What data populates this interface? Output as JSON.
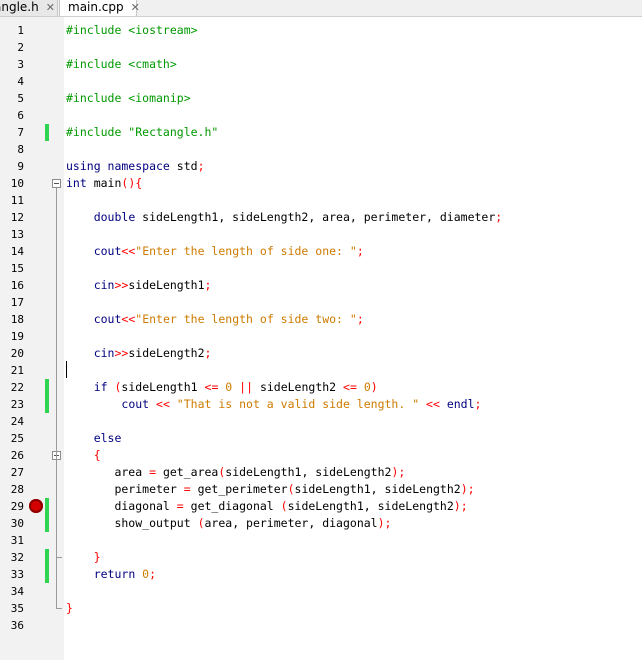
{
  "tabs": [
    {
      "label": "angle.h",
      "close": "✕"
    },
    {
      "label": "main.cpp",
      "close": "✕"
    }
  ],
  "colors": {
    "keyword": "#000080",
    "string": "#ce7b00",
    "number": "#ce7b00",
    "preprocessor": "#009900",
    "operator": "#ff0000",
    "change_marker": "#2fd552",
    "breakpoint": "#d40000"
  },
  "lines": [
    {
      "n": "1",
      "tokens": [
        [
          "pp",
          "#include <iostream>"
        ]
      ]
    },
    {
      "n": "2",
      "tokens": []
    },
    {
      "n": "3",
      "tokens": [
        [
          "pp",
          "#include <cmath>"
        ]
      ]
    },
    {
      "n": "4",
      "tokens": []
    },
    {
      "n": "5",
      "tokens": [
        [
          "pp",
          "#include <iomanip>"
        ]
      ]
    },
    {
      "n": "6",
      "tokens": []
    },
    {
      "n": "7",
      "tokens": [
        [
          "pp",
          "#include \"Rectangle.h\""
        ]
      ],
      "changed": true
    },
    {
      "n": "8",
      "tokens": []
    },
    {
      "n": "9",
      "tokens": [
        [
          "kw",
          "using namespace "
        ],
        [
          "tx",
          "std"
        ],
        [
          "op",
          ";"
        ]
      ]
    },
    {
      "n": "10",
      "tokens": [
        [
          "kw",
          "int "
        ],
        [
          "tx",
          "main"
        ],
        [
          "op",
          "(){"
        ]
      ],
      "fold": true
    },
    {
      "n": "11",
      "tokens": []
    },
    {
      "n": "12",
      "tokens": [
        [
          "tx",
          "    "
        ],
        [
          "kw",
          "double "
        ],
        [
          "tx",
          "sideLength1, sideLength2, area, perimeter, diameter"
        ],
        [
          "op",
          ";"
        ]
      ]
    },
    {
      "n": "13",
      "tokens": []
    },
    {
      "n": "14",
      "tokens": [
        [
          "tx",
          "    "
        ],
        [
          "kw",
          "cout"
        ],
        [
          "op",
          "<<"
        ],
        [
          "st",
          "\"Enter the length of side one: \""
        ],
        [
          "op",
          ";"
        ]
      ]
    },
    {
      "n": "15",
      "tokens": []
    },
    {
      "n": "16",
      "tokens": [
        [
          "tx",
          "    "
        ],
        [
          "kw",
          "cin"
        ],
        [
          "op",
          ">>"
        ],
        [
          "tx",
          "sideLength1"
        ],
        [
          "op",
          ";"
        ]
      ]
    },
    {
      "n": "17",
      "tokens": []
    },
    {
      "n": "18",
      "tokens": [
        [
          "tx",
          "    "
        ],
        [
          "kw",
          "cout"
        ],
        [
          "op",
          "<<"
        ],
        [
          "st",
          "\"Enter the length of side two: \""
        ],
        [
          "op",
          ";"
        ]
      ]
    },
    {
      "n": "19",
      "tokens": []
    },
    {
      "n": "20",
      "tokens": [
        [
          "tx",
          "    "
        ],
        [
          "kw",
          "cin"
        ],
        [
          "op",
          ">>"
        ],
        [
          "tx",
          "sideLength2"
        ],
        [
          "op",
          ";"
        ]
      ]
    },
    {
      "n": "21",
      "tokens": []
    },
    {
      "n": "22",
      "tokens": [
        [
          "tx",
          "    "
        ],
        [
          "kw",
          "if "
        ],
        [
          "op",
          "("
        ],
        [
          "tx",
          "sideLength1 "
        ],
        [
          "op",
          "<= "
        ],
        [
          "nu",
          "0 "
        ],
        [
          "op",
          "|| "
        ],
        [
          "tx",
          "sideLength2 "
        ],
        [
          "op",
          "<= "
        ],
        [
          "nu",
          "0"
        ],
        [
          "op",
          ")"
        ]
      ],
      "changed": true
    },
    {
      "n": "23",
      "tokens": [
        [
          "tx",
          "        "
        ],
        [
          "kw",
          "cout "
        ],
        [
          "op",
          "<< "
        ],
        [
          "st",
          "\"That is not a valid side length. \" "
        ],
        [
          "op",
          "<< "
        ],
        [
          "kw",
          "endl"
        ],
        [
          "op",
          ";"
        ]
      ],
      "changed": true
    },
    {
      "n": "24",
      "tokens": []
    },
    {
      "n": "25",
      "tokens": [
        [
          "tx",
          "    "
        ],
        [
          "kw",
          "else"
        ]
      ]
    },
    {
      "n": "26",
      "tokens": [
        [
          "tx",
          "    "
        ],
        [
          "op",
          "{"
        ]
      ],
      "fold": true
    },
    {
      "n": "27",
      "tokens": [
        [
          "tx",
          "       area "
        ],
        [
          "op",
          "= "
        ],
        [
          "tx",
          "get_area"
        ],
        [
          "op",
          "("
        ],
        [
          "tx",
          "sideLength1, sideLength2"
        ],
        [
          "op",
          ");"
        ]
      ]
    },
    {
      "n": "28",
      "tokens": [
        [
          "tx",
          "       perimeter "
        ],
        [
          "op",
          "= "
        ],
        [
          "tx",
          "get_perimeter"
        ],
        [
          "op",
          "("
        ],
        [
          "tx",
          "sideLength1, sideLength2"
        ],
        [
          "op",
          ");"
        ]
      ]
    },
    {
      "n": "29",
      "tokens": [
        [
          "tx",
          "       diagonal "
        ],
        [
          "op",
          "= "
        ],
        [
          "tx",
          "get_diagonal "
        ],
        [
          "op",
          "("
        ],
        [
          "tx",
          "sideLength1, sideLength2"
        ],
        [
          "op",
          ");"
        ]
      ],
      "changed": true,
      "breakpoint": true
    },
    {
      "n": "30",
      "tokens": [
        [
          "tx",
          "       show_output "
        ],
        [
          "op",
          "("
        ],
        [
          "tx",
          "area, perimeter, diagonal"
        ],
        [
          "op",
          ");"
        ]
      ],
      "changed": true
    },
    {
      "n": "31",
      "tokens": []
    },
    {
      "n": "32",
      "tokens": [
        [
          "tx",
          "    "
        ],
        [
          "op",
          "}"
        ]
      ],
      "changed": true
    },
    {
      "n": "33",
      "tokens": [
        [
          "tx",
          "    "
        ],
        [
          "kw",
          "return "
        ],
        [
          "nu",
          "0"
        ],
        [
          "op",
          ";"
        ]
      ],
      "changed": true
    },
    {
      "n": "34",
      "tokens": []
    },
    {
      "n": "35",
      "tokens": [
        [
          "op",
          "}"
        ]
      ]
    },
    {
      "n": "36",
      "tokens": []
    }
  ]
}
